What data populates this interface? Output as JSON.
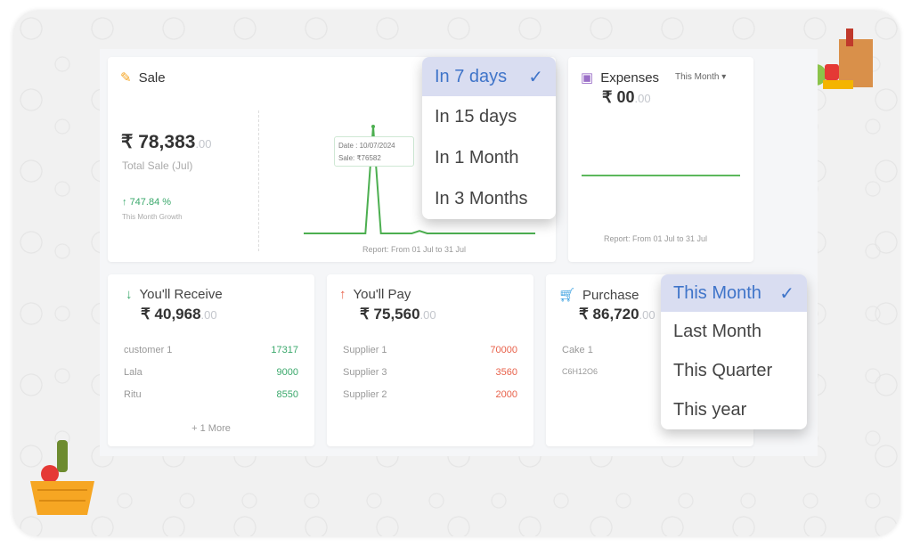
{
  "sale": {
    "title": "Sale",
    "amount": "₹ 78,383",
    "decimals": ".00",
    "subtitle": "Total Sale (Jul)",
    "growth": "747.84 %",
    "growth_label": "This Month Growth",
    "tooltip_date": "Date : 10/07/2024",
    "tooltip_sale": "Sale: ₹76582",
    "report": "Report: From 01 Jul to 31 Jul",
    "chart_data": {
      "type": "line",
      "x": [
        1,
        2,
        3,
        4,
        5,
        6,
        7,
        8,
        9,
        10,
        11,
        12,
        13,
        14,
        15,
        16,
        17,
        18,
        19,
        20,
        21,
        22,
        23,
        24,
        25,
        26,
        27,
        28,
        29,
        30,
        31
      ],
      "values": [
        0,
        0,
        0,
        0,
        0,
        0,
        0,
        0,
        0,
        76582,
        0,
        0,
        0,
        0,
        0,
        1800,
        0,
        0,
        0,
        0,
        0,
        0,
        0,
        0,
        0,
        0,
        0,
        0,
        0,
        0,
        0
      ],
      "color": "#4caf50"
    }
  },
  "sale_dropdown": {
    "items": [
      "In 7 days",
      "In 15 days",
      "In 1 Month",
      "In 3 Months"
    ],
    "selected": 0
  },
  "expenses": {
    "title": "Expenses",
    "period": "This Month",
    "amount": "₹ 00",
    "decimals": ".00",
    "report": "Report: From 01 Jul to 31 Jul"
  },
  "receive": {
    "title": "You'll Receive",
    "amount": "₹ 40,968",
    "decimals": ".00",
    "rows": [
      {
        "name": "customer 1",
        "value": "17317"
      },
      {
        "name": "Lala",
        "value": "9000"
      },
      {
        "name": "Ritu",
        "value": "8550"
      }
    ],
    "more": "+ 1 More"
  },
  "pay": {
    "title": "You'll Pay",
    "amount": "₹ 75,560",
    "decimals": ".00",
    "rows": [
      {
        "name": "Supplier 1",
        "value": "70000"
      },
      {
        "name": "Supplier 3",
        "value": "3560"
      },
      {
        "name": "Supplier 2",
        "value": "2000"
      }
    ]
  },
  "purchase": {
    "title": "Purchase",
    "amount": "₹ 86,720",
    "decimals": ".00",
    "rows": [
      {
        "name": "Cake 1"
      },
      {
        "name": "C6H12O6"
      }
    ]
  },
  "purchase_dropdown": {
    "items": [
      "This Month",
      "Last Month",
      "This Quarter",
      "This year"
    ],
    "selected": 0
  },
  "colors": {
    "accent": "#3f74c9",
    "green": "#3aa86b",
    "red": "#e8614a"
  }
}
